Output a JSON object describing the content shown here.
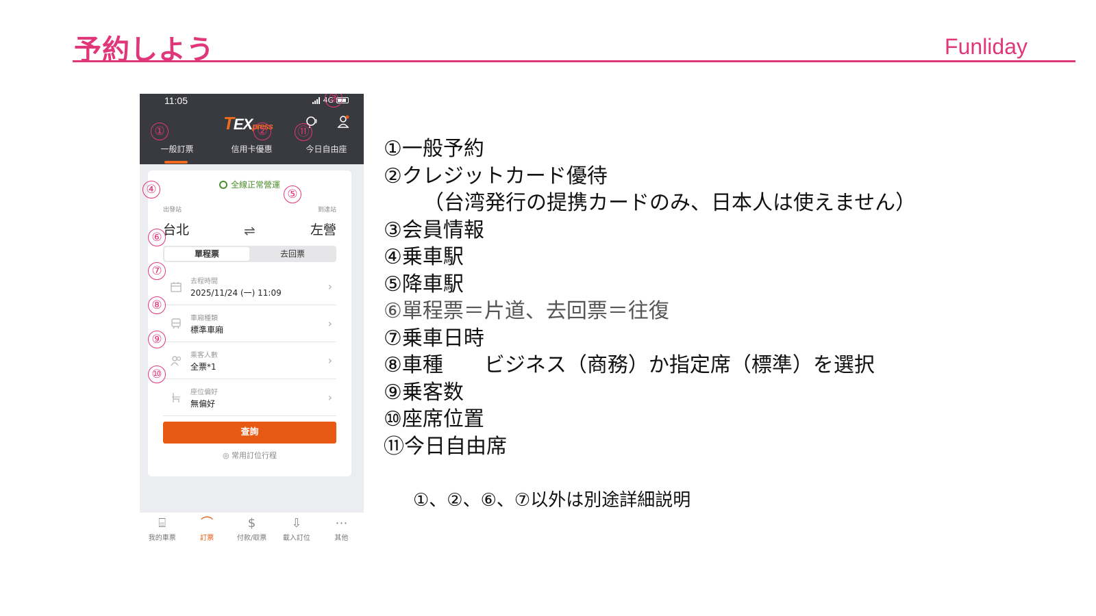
{
  "slide": {
    "title": "予約しよう",
    "brand": "Funliday"
  },
  "phone": {
    "status_time": "11:05",
    "network": "4G",
    "logo": {
      "t": "T",
      "main": "EX",
      "sub": "press"
    },
    "tabs": [
      "一般訂票",
      "信用卡優惠",
      "今日自由座"
    ],
    "status_text": "全線正常營運",
    "from_label": "出發站",
    "to_label": "到達站",
    "from_station": "台北",
    "to_station": "左營",
    "swap_symbol": "⇌",
    "trip_types": [
      "單程票",
      "去回票"
    ],
    "rows": [
      {
        "label": "去程時間",
        "value": "2025/11/24 (一) 11:09",
        "icon": "calendar-icon"
      },
      {
        "label": "車廂種類",
        "value": "標準車廂",
        "icon": "train-icon"
      },
      {
        "label": "乘客人數",
        "value": "全票*1",
        "icon": "passenger-icon"
      },
      {
        "label": "座位偏好",
        "value": "無偏好",
        "icon": "seat-icon"
      }
    ],
    "search_button": "查詢",
    "favorite_link": "常用訂位行程",
    "bottom_nav": [
      {
        "label": "我的車票",
        "icon": "ticket-icon"
      },
      {
        "label": "訂票",
        "icon": "booking-icon",
        "active": true
      },
      {
        "label": "付款/取票",
        "icon": "payment-icon"
      },
      {
        "label": "載入訂位",
        "icon": "download-icon"
      },
      {
        "label": "其他",
        "icon": "more-icon"
      }
    ],
    "markers": [
      "①",
      "②",
      "③",
      "④",
      "⑤",
      "⑥",
      "⑦",
      "⑧",
      "⑨",
      "⑩",
      "⑪"
    ]
  },
  "legend": [
    "①一般予約",
    "②クレジットカード優待",
    "（台湾発行の提携カードのみ、日本人は使えません）",
    "③会員情報",
    "④乗車駅",
    "⑤降車駅",
    "⑥單程票＝片道、去回票＝往復",
    "⑦乗車日時",
    "⑧車種　　ビジネス（商務）か指定席（標準）を選択",
    "⑨乗客数",
    "⑩座席位置",
    "⑪今日自由席"
  ],
  "footnote": "①、②、⑥、⑦以外は別途詳細説明",
  "colors": {
    "accent_pink": "#e0367a",
    "accent_orange": "#e85a14",
    "header_dark": "#393a3f",
    "status_green": "#4c8c2b"
  }
}
